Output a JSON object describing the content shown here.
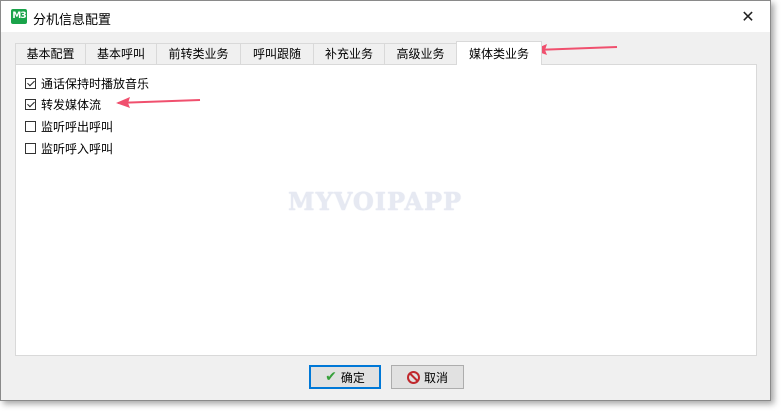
{
  "window": {
    "title": "分机信息配置",
    "app_icon_text": "M3"
  },
  "tabs": [
    {
      "label": "基本配置",
      "active": false
    },
    {
      "label": "基本呼叫",
      "active": false
    },
    {
      "label": "前转类业务",
      "active": false
    },
    {
      "label": "呼叫跟随",
      "active": false
    },
    {
      "label": "补充业务",
      "active": false
    },
    {
      "label": "高级业务",
      "active": false
    },
    {
      "label": "媒体类业务",
      "active": true
    }
  ],
  "options": [
    {
      "label": "通话保持时播放音乐",
      "checked": true
    },
    {
      "label": "转发媒体流",
      "checked": true
    },
    {
      "label": "监听呼出呼叫",
      "checked": false
    },
    {
      "label": "监听呼入呼叫",
      "checked": false
    }
  ],
  "watermark": "MYVOIPAPP",
  "buttons": {
    "ok_label": "确定",
    "cancel_label": "取消"
  },
  "colors": {
    "annotation_arrow": "#f0506e",
    "app_icon": "#1aa34a"
  }
}
